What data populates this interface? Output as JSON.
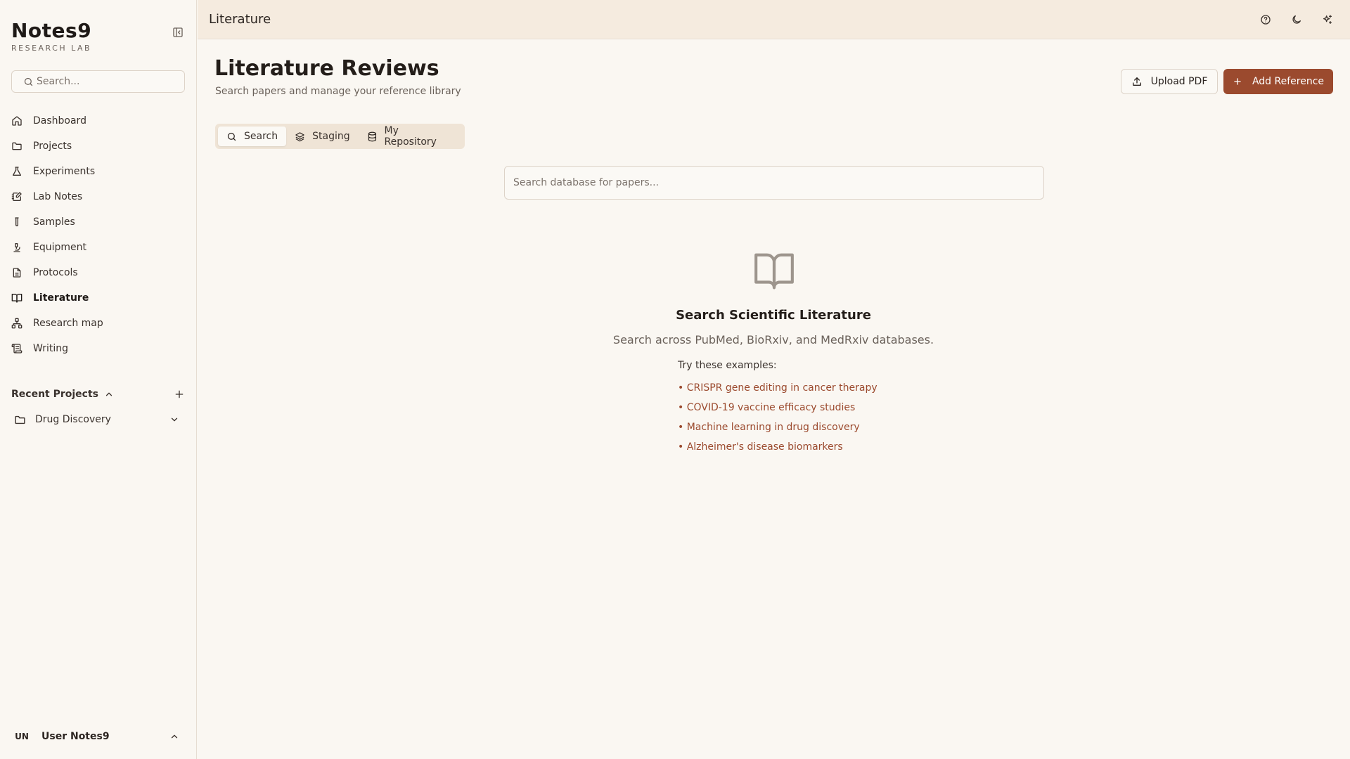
{
  "sidebar": {
    "brand": "Notes9",
    "brand_sub": "RESEARCH LAB",
    "search_placeholder": "Search...",
    "items": [
      {
        "label": "Dashboard",
        "icon": "home-icon"
      },
      {
        "label": "Projects",
        "icon": "folder-icon"
      },
      {
        "label": "Experiments",
        "icon": "flask-icon"
      },
      {
        "label": "Lab Notes",
        "icon": "notebook-pen-icon"
      },
      {
        "label": "Samples",
        "icon": "test-tube-icon"
      },
      {
        "label": "Equipment",
        "icon": "microscope-icon"
      },
      {
        "label": "Protocols",
        "icon": "file-text-icon"
      },
      {
        "label": "Literature",
        "icon": "book-open-icon",
        "active": true
      },
      {
        "label": "Research map",
        "icon": "network-icon"
      },
      {
        "label": "Writing",
        "icon": "scroll-icon"
      }
    ],
    "recent_title": "Recent Projects",
    "recent_items": [
      {
        "label": "Drug Discovery"
      }
    ],
    "user": {
      "initials": "UN",
      "name": "User Notes9"
    }
  },
  "topbar": {
    "title": "Literature"
  },
  "main": {
    "title": "Literature Reviews",
    "subtitle": "Search papers and manage your reference library",
    "upload_label": "Upload PDF",
    "add_label": "Add Reference",
    "tabs": [
      {
        "label": "Search",
        "active": true
      },
      {
        "label": "Staging"
      },
      {
        "label": "My Repository"
      }
    ],
    "search_placeholder": "Search database for papers...",
    "empty": {
      "title": "Search Scientific Literature",
      "desc": "Search across PubMed, BioRxiv, and MedRxiv databases.",
      "examples_head": "Try these examples:",
      "examples": [
        "• CRISPR gene editing in cancer therapy",
        "• COVID-19 vaccine efficacy studies",
        "• Machine learning in drug discovery",
        "• Alzheimer's disease biomarkers"
      ]
    }
  },
  "colors": {
    "accent": "#9b4a2e",
    "topbar_bg": "#f5ebdf",
    "page_bg": "#faf7f2"
  }
}
